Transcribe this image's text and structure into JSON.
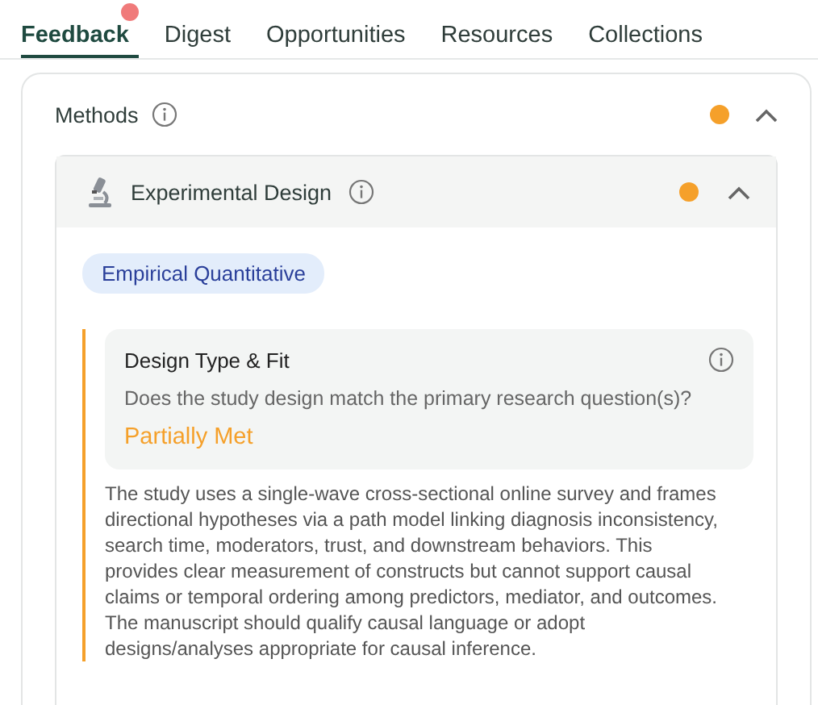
{
  "tabs": [
    {
      "label": "Feedback",
      "selected": true,
      "notification": true
    },
    {
      "label": "Digest",
      "selected": false,
      "notification": false
    },
    {
      "label": "Opportunities",
      "selected": false,
      "notification": false
    },
    {
      "label": "Resources",
      "selected": false,
      "notification": false
    },
    {
      "label": "Collections",
      "selected": false,
      "notification": false
    }
  ],
  "section": {
    "title": "Methods",
    "color": "#f5a02a",
    "expanded": true,
    "subsection": {
      "title": "Experimental Design",
      "color": "#f5a02a",
      "expanded": true,
      "tag": "Empirical Quantitative",
      "criterion": {
        "title": "Design Type & Fit",
        "question": "Does the study design match the primary research question(s)?",
        "rating": "Partially Met",
        "color": "#f5a02a",
        "explanation": "The study uses a single-wave cross-sectional online survey and frames directional hypotheses via a path model linking diagnosis inconsistency, search time, moderators, trust, and downstream behaviors. This provides clear measurement of constructs but cannot support causal claims or temporal ordering among predictors, mediator, and outcomes. The manuscript should qualify causal language or adopt designs/analyses appropriate for causal inference."
      }
    }
  }
}
